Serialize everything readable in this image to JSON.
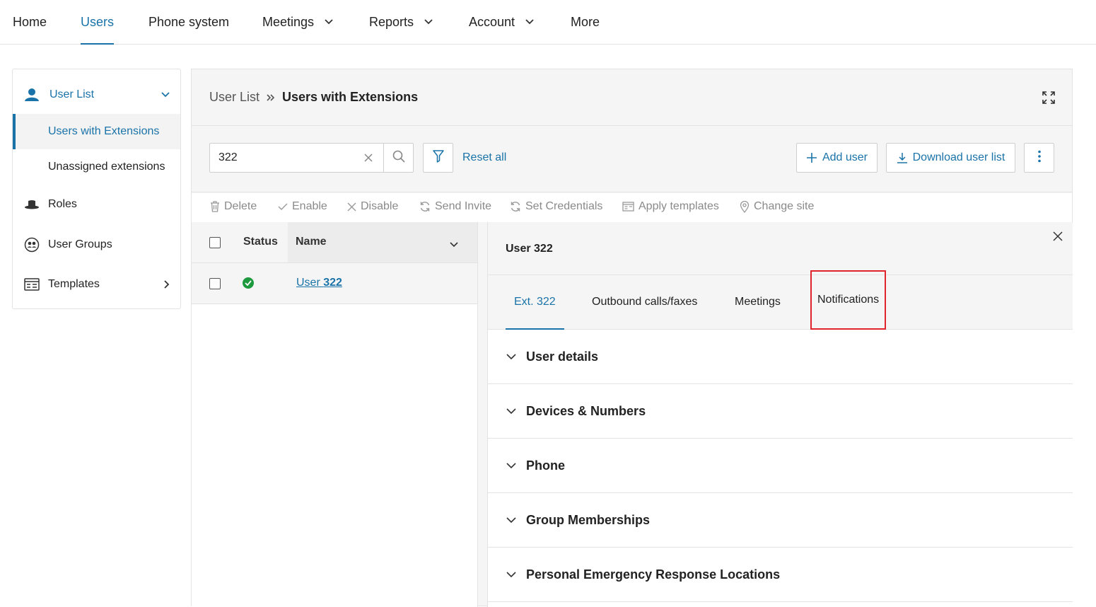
{
  "nav": {
    "items": [
      {
        "label": "Home"
      },
      {
        "label": "Users"
      },
      {
        "label": "Phone system"
      },
      {
        "label": "Meetings"
      },
      {
        "label": "Reports"
      },
      {
        "label": "Account"
      },
      {
        "label": "More"
      }
    ],
    "active": "Users"
  },
  "sidebar": {
    "user_list": "User List",
    "users_with_extensions": "Users with Extensions",
    "unassigned_extensions": "Unassigned extensions",
    "roles": "Roles",
    "user_groups": "User Groups",
    "templates": "Templates"
  },
  "breadcrumb": {
    "parent": "User List",
    "current": "Users with Extensions"
  },
  "toolbar": {
    "search_value": "322",
    "reset_all": "Reset all",
    "add_user": "Add user",
    "download_user_list": "Download user list"
  },
  "actions": {
    "delete": "Delete",
    "enable": "Enable",
    "disable": "Disable",
    "send_invite": "Send Invite",
    "set_credentials": "Set Credentials",
    "apply_templates": "Apply templates",
    "change_site": "Change site"
  },
  "table": {
    "headers": {
      "status": "Status",
      "name": "Name"
    },
    "rows": [
      {
        "name_prefix": "User ",
        "name_number": "322",
        "status": "active"
      }
    ]
  },
  "detail": {
    "title": "User 322",
    "tabs": [
      "Ext. 322",
      "Outbound calls/faxes",
      "Meetings",
      "Notifications"
    ],
    "active_tab": "Ext. 322",
    "highlighted_tab": "Notifications",
    "sections": [
      "User details",
      "Devices & Numbers",
      "Phone",
      "Group Memberships",
      "Personal Emergency Response Locations"
    ]
  },
  "colors": {
    "accent": "#1a73a8",
    "status_active": "#1e9a3e",
    "highlight_box": "#e0242b"
  }
}
